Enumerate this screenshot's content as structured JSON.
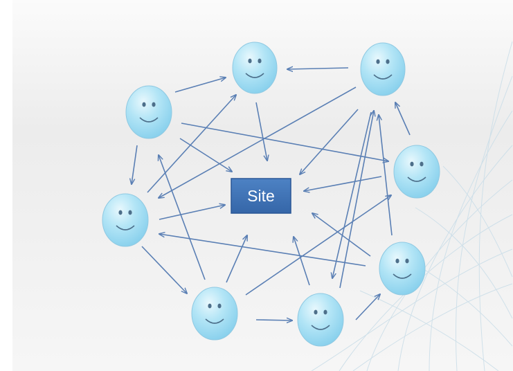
{
  "diagram": {
    "center_node": {
      "label": "Site",
      "fill_color": "#3f74b8",
      "border_color": "#2a5796"
    },
    "people_nodes": [
      {
        "id": "top-center"
      },
      {
        "id": "top-right"
      },
      {
        "id": "upper-left"
      },
      {
        "id": "right"
      },
      {
        "id": "left"
      },
      {
        "id": "lower-right"
      },
      {
        "id": "bottom-left"
      },
      {
        "id": "bottom-center"
      }
    ],
    "arrow_color": "#5a7fb4",
    "face_color": "#a7e0f4"
  }
}
